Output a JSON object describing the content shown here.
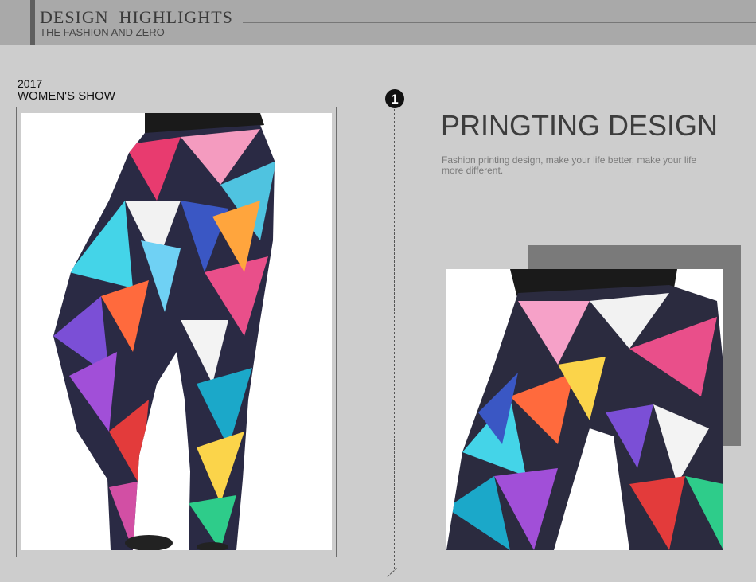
{
  "header": {
    "title": "DESIGN  HIGHLIGHTS",
    "subtitle": "THE FASHION AND ZERO"
  },
  "show": {
    "year": "2017",
    "label": "WOMEN'S SHOW"
  },
  "feature": {
    "step_number": "1",
    "heading": "PRINGTING DESIGN",
    "description": "Fashion printing design, make your life better, make your life more different."
  },
  "images": {
    "left_photo": "geometric-print-leggings-full-view",
    "right_photo": "geometric-print-leggings-closeup"
  },
  "colors": {
    "background": "#cdcdcd",
    "header_bar": "#a9a9a9",
    "accent_block": "#7a7a7a"
  }
}
